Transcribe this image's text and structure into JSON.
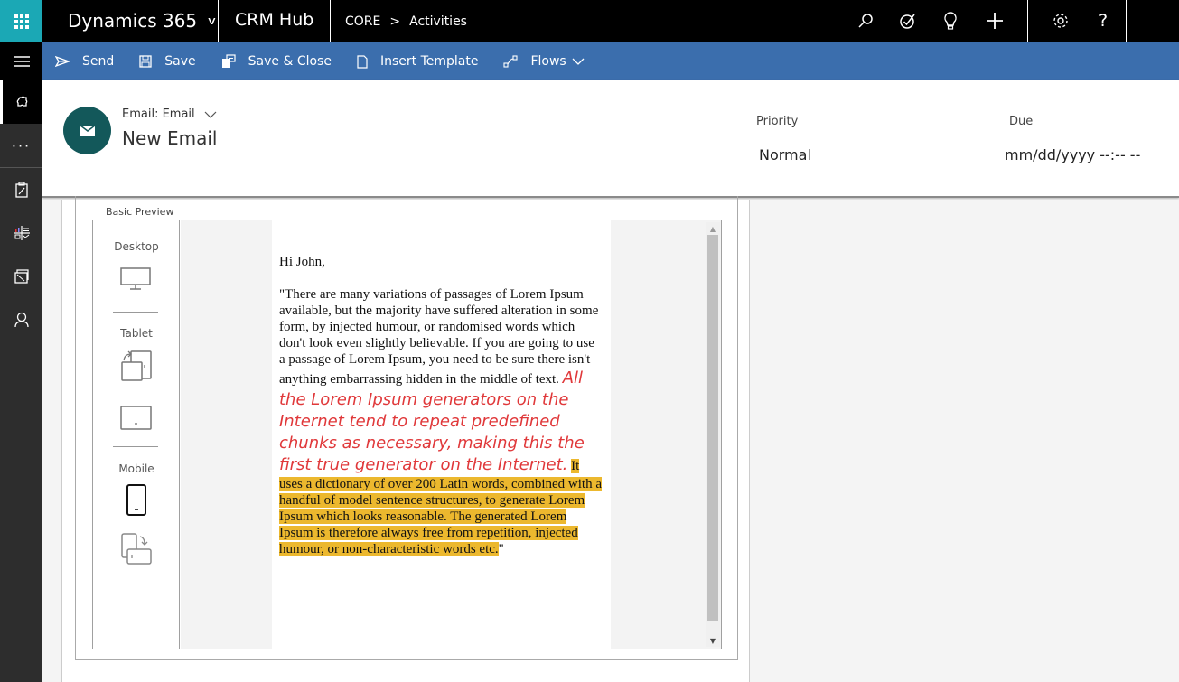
{
  "topbar": {
    "app_name": "Dynamics 365",
    "hub_name": "CRM Hub",
    "breadcrumb": [
      "CORE",
      "Activities"
    ],
    "icons": [
      "search-icon",
      "task-flow-icon",
      "lightbulb-icon",
      "add-icon",
      "settings-icon",
      "help-icon"
    ]
  },
  "commands": [
    {
      "label": "Send",
      "icon": "send-icon"
    },
    {
      "label": "Save",
      "icon": "save-icon"
    },
    {
      "label": "Save & Close",
      "icon": "save-close-icon"
    },
    {
      "label": "Insert Template",
      "icon": "document-icon"
    },
    {
      "label": "Flows",
      "icon": "flow-icon",
      "has_dropdown": true
    }
  ],
  "left_rail": [
    "hamburger-icon",
    "puzzle-icon",
    "more-icon",
    "clipboard-icon",
    "dashboard-icon",
    "folder-icon",
    "person-icon"
  ],
  "header": {
    "entity_type": "Email: Email",
    "record_title": "New Email",
    "fields": [
      {
        "label": "Priority",
        "value": "Normal"
      },
      {
        "label": "Due",
        "value": "mm/dd/yyyy --:-- --"
      }
    ]
  },
  "preview": {
    "section_label": "Basic Preview",
    "devices": {
      "desktop": "Desktop",
      "tablet": "Tablet",
      "mobile": "Mobile"
    },
    "email": {
      "greeting": "Hi John,",
      "body_plain": "\"There are many variations of passages of Lorem Ipsum available, but the majority have suffered alteration in some form, by injected humour, or randomised words which don't look even slightly believable. If you are going to use a passage of Lorem Ipsum, you need to be sure there isn't anything embarrassing hidden in the middle of text.",
      "body_red": "All the Lorem Ipsum generators on the Internet tend to repeat predefined chunks as necessary, making this the first true generator on the Internet.",
      "body_highlight": "It uses a dictionary of over 200 Latin words, combined with a handful of model sentence structures, to generate Lorem Ipsum which looks reasonable. The generated Lorem Ipsum is therefore always free from repetition, injected humour, or non-characteristic words etc.",
      "closing_quote": "\""
    },
    "colors": {
      "red_text": "#e0383a",
      "highlight": "#ecb82e"
    }
  },
  "colors": {
    "waffle": "#1ba8b5",
    "command_bar": "#3b6ead",
    "avatar": "#13585a"
  }
}
